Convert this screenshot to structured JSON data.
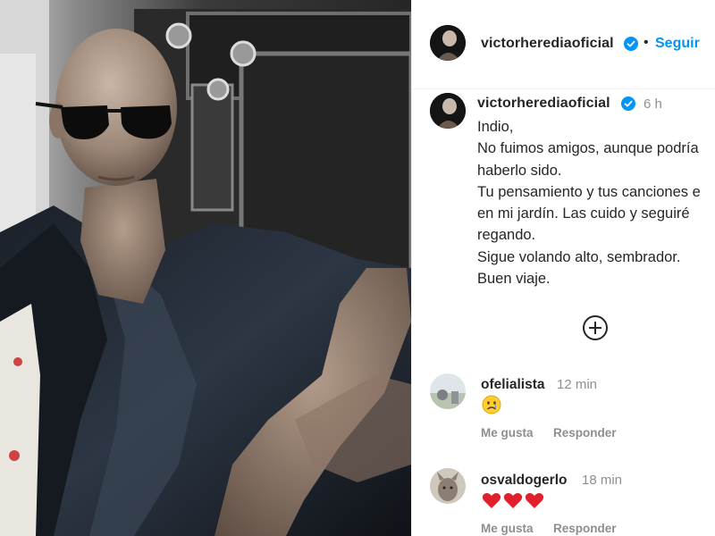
{
  "post": {
    "username": "victorherediaoficial",
    "follow_label": "Seguir",
    "verified_icon": "verified-badge-icon",
    "accent_color": "#0095f6",
    "photo_description_icon": "portrait-photo"
  },
  "caption": {
    "username": "victorherediaoficial",
    "time": "6 h",
    "lines": [
      "Indio,",
      "No fuimos amigos, aunque podría",
      "haberlo sido.",
      "Tu pensamiento y tus canciones e",
      "en mi jardín. Las cuido y seguiré",
      "regando.",
      "Sigue volando alto, sembrador.",
      "Buen viaje."
    ]
  },
  "more_comments_icon": "plus-circle-icon",
  "comments": [
    {
      "username": "ofelialista",
      "time": "12 min",
      "content_icon": "sad-face-emoji",
      "like_label": "Me gusta",
      "reply_label": "Responder"
    },
    {
      "username": "osvaldogerlo",
      "time": "18 min",
      "content_icon": "three-red-hearts-emoji",
      "like_label": "Me gusta",
      "reply_label": "Responder"
    }
  ]
}
